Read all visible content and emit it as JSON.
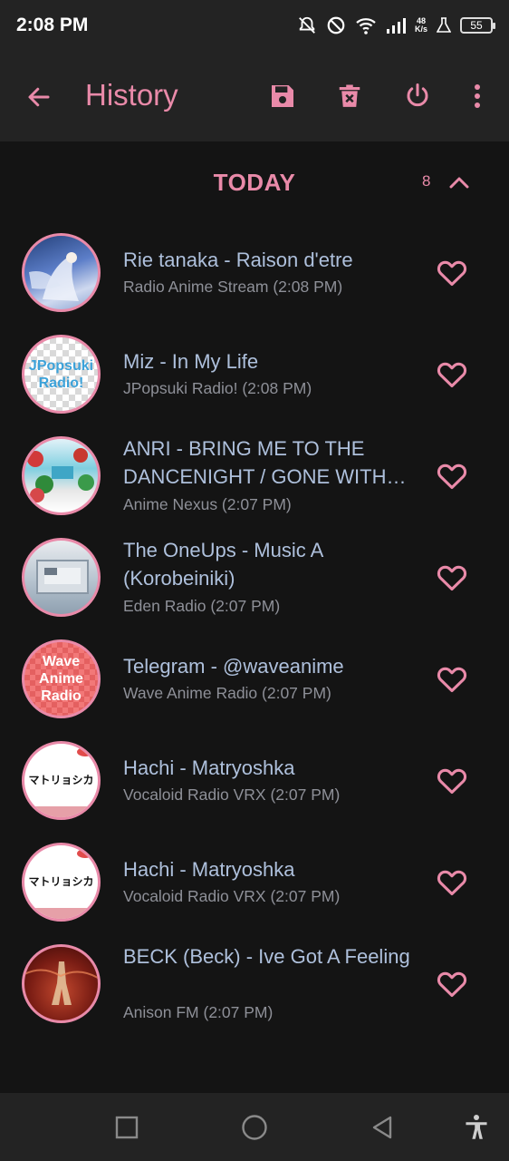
{
  "status_bar": {
    "time": "2:08 PM",
    "net_speed_value": "48",
    "net_speed_unit": "K/s",
    "battery": "55"
  },
  "app_bar": {
    "title": "History"
  },
  "section": {
    "title": "TODAY",
    "count": "8"
  },
  "colors": {
    "accent": "#e98aa9",
    "title_text": "#aec0dc",
    "meta_text": "#8e9098",
    "background": "#141414",
    "bar_background": "#232323"
  },
  "history": [
    {
      "title": "Rie tanaka - Raison d'etre",
      "meta": "Radio Anime Stream (2:08 PM)",
      "art_icon": "anime-art-icon"
    },
    {
      "title": "Miz - In My Life",
      "meta": "JPopsuki Radio! (2:08 PM)",
      "art_text": "JPopsuki Radio!"
    },
    {
      "title": "ANRI - BRING ME TO THE DANCENIGHT / GONE WITH THE WIND",
      "meta": "Anime Nexus (2:07 PM)",
      "art_icon": "album-art-icon"
    },
    {
      "title": "The OneUps - Music A (Korobeiniki)",
      "meta": "Eden Radio (2:07 PM)",
      "art_icon": "album-art-icon"
    },
    {
      "title": "Telegram - @waveanime",
      "meta": "Wave Anime Radio (2:07 PM)",
      "art_text": "Wave Anime Radio"
    },
    {
      "title": "Hachi - Matryoshka",
      "meta": "Vocaloid Radio VRX (2:07 PM)",
      "art_text": "マトリョシカ"
    },
    {
      "title": "Hachi - Matryoshka",
      "meta": "Vocaloid Radio VRX (2:07 PM)",
      "art_text": "マトリョシカ"
    },
    {
      "title": "BECK (Beck) - Ive Got A Feeling",
      "meta": "Anison FM (2:07 PM)",
      "art_icon": "album-art-icon"
    }
  ]
}
